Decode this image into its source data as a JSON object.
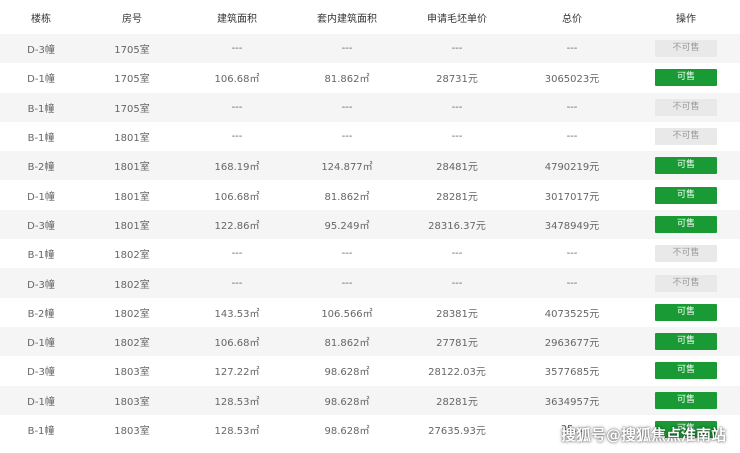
{
  "columns": [
    "楼栋",
    "房号",
    "建筑面积",
    "套内建筑面积",
    "申请毛坯单价",
    "总价",
    "操作"
  ],
  "colors": {
    "available": "#1a9a35",
    "unavailable": "#e9e9e9",
    "stripe": "#f5f5f5"
  },
  "rows": [
    {
      "building": "D-3幢",
      "room": "1705室",
      "area": "---",
      "inner_area": "---",
      "unit_price": "---",
      "total": "---",
      "action": "不可售",
      "available": false
    },
    {
      "building": "D-1幢",
      "room": "1705室",
      "area": "106.68㎡",
      "inner_area": "81.862㎡",
      "unit_price": "28731元",
      "total": "3065023元",
      "action": "可售",
      "available": true
    },
    {
      "building": "B-1幢",
      "room": "1705室",
      "area": "---",
      "inner_area": "---",
      "unit_price": "---",
      "total": "---",
      "action": "不可售",
      "available": false
    },
    {
      "building": "B-1幢",
      "room": "1801室",
      "area": "---",
      "inner_area": "---",
      "unit_price": "---",
      "total": "---",
      "action": "不可售",
      "available": false
    },
    {
      "building": "B-2幢",
      "room": "1801室",
      "area": "168.19㎡",
      "inner_area": "124.877㎡",
      "unit_price": "28481元",
      "total": "4790219元",
      "action": "可售",
      "available": true
    },
    {
      "building": "D-1幢",
      "room": "1801室",
      "area": "106.68㎡",
      "inner_area": "81.862㎡",
      "unit_price": "28281元",
      "total": "3017017元",
      "action": "可售",
      "available": true
    },
    {
      "building": "D-3幢",
      "room": "1801室",
      "area": "122.86㎡",
      "inner_area": "95.249㎡",
      "unit_price": "28316.37元",
      "total": "3478949元",
      "action": "可售",
      "available": true
    },
    {
      "building": "B-1幢",
      "room": "1802室",
      "area": "---",
      "inner_area": "---",
      "unit_price": "---",
      "total": "---",
      "action": "不可售",
      "available": false
    },
    {
      "building": "D-3幢",
      "room": "1802室",
      "area": "---",
      "inner_area": "---",
      "unit_price": "---",
      "total": "---",
      "action": "不可售",
      "available": false
    },
    {
      "building": "B-2幢",
      "room": "1802室",
      "area": "143.53㎡",
      "inner_area": "106.566㎡",
      "unit_price": "28381元",
      "total": "4073525元",
      "action": "可售",
      "available": true
    },
    {
      "building": "D-1幢",
      "room": "1802室",
      "area": "106.68㎡",
      "inner_area": "81.862㎡",
      "unit_price": "27781元",
      "total": "2963677元",
      "action": "可售",
      "available": true
    },
    {
      "building": "D-3幢",
      "room": "1803室",
      "area": "127.22㎡",
      "inner_area": "98.628㎡",
      "unit_price": "28122.03元",
      "total": "3577685元",
      "action": "可售",
      "available": true
    },
    {
      "building": "D-1幢",
      "room": "1803室",
      "area": "128.53㎡",
      "inner_area": "98.628㎡",
      "unit_price": "28281元",
      "total": "3634957元",
      "action": "可售",
      "available": true
    },
    {
      "building": "B-1幢",
      "room": "1803室",
      "area": "128.53㎡",
      "inner_area": "98.628㎡",
      "unit_price": "27635.93元",
      "total": "35…",
      "action": "可售",
      "available": true
    }
  ],
  "watermark": "搜狐号@搜狐焦点淮南站"
}
